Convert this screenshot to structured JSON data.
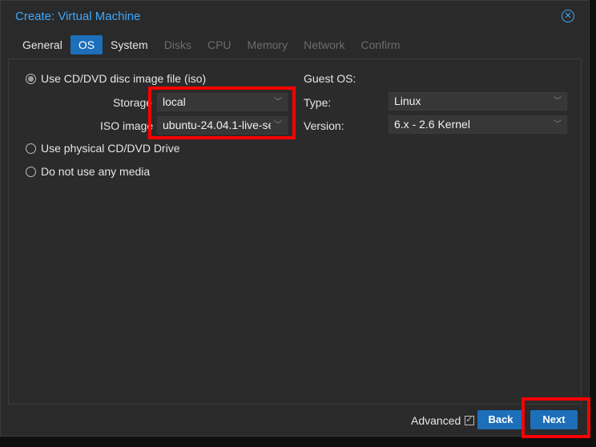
{
  "window": {
    "title": "Create: Virtual Machine"
  },
  "tabs": [
    {
      "label": "General",
      "state": "normal"
    },
    {
      "label": "OS",
      "state": "active"
    },
    {
      "label": "System",
      "state": "normal"
    },
    {
      "label": "Disks",
      "state": "disabled"
    },
    {
      "label": "CPU",
      "state": "disabled"
    },
    {
      "label": "Memory",
      "state": "disabled"
    },
    {
      "label": "Network",
      "state": "disabled"
    },
    {
      "label": "Confirm",
      "state": "disabled"
    }
  ],
  "media": {
    "option_iso": "Use CD/DVD disc image file (iso)",
    "option_physical": "Use physical CD/DVD Drive",
    "option_none": "Do not use any media",
    "selected": "iso",
    "storage_label": "Storage",
    "storage_value": "local",
    "iso_label": "ISO image",
    "iso_value": "ubuntu-24.04.1-live-se"
  },
  "guest_os": {
    "heading": "Guest OS:",
    "type_label": "Type:",
    "type_value": "Linux",
    "version_label": "Version:",
    "version_value": "6.x - 2.6 Kernel"
  },
  "footer": {
    "advanced_label": "Advanced",
    "advanced_checked": true,
    "back_label": "Back",
    "next_label": "Next"
  },
  "colors": {
    "accent": "#1c6fb8",
    "title": "#3ea8ff",
    "highlight": "#ff0000"
  }
}
